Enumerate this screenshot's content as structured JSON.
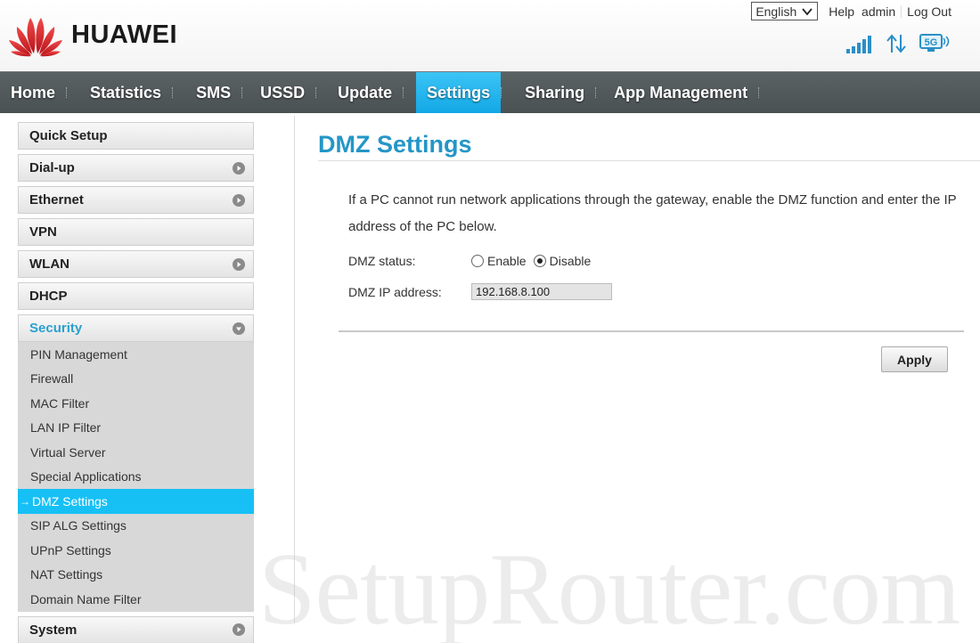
{
  "header": {
    "brand": "HUAWEI",
    "language": "English",
    "links": [
      "Help",
      "admin",
      "Log Out"
    ],
    "status_icons": [
      "signal-strength-icon",
      "data-transfer-icon",
      "5g-wifi-icon"
    ],
    "wifi_band_label": "5G"
  },
  "nav": {
    "items": [
      {
        "label": "Home",
        "active": false
      },
      {
        "label": "Statistics",
        "active": false
      },
      {
        "label": "SMS",
        "active": false
      },
      {
        "label": "USSD",
        "active": false
      },
      {
        "label": "Update",
        "active": false
      },
      {
        "label": "Settings",
        "active": true
      },
      {
        "label": "Sharing",
        "active": false
      },
      {
        "label": "App Management",
        "active": false
      }
    ]
  },
  "sidebar": {
    "items": [
      {
        "label": "Quick Setup",
        "expandable": false
      },
      {
        "label": "Dial-up",
        "expandable": true
      },
      {
        "label": "Ethernet",
        "expandable": true
      },
      {
        "label": "VPN",
        "expandable": false
      },
      {
        "label": "WLAN",
        "expandable": true
      },
      {
        "label": "DHCP",
        "expandable": false
      },
      {
        "label": "Security",
        "expandable": true,
        "open": true
      },
      {
        "label": "System",
        "expandable": true
      }
    ],
    "security_subitems": [
      "PIN Management",
      "Firewall",
      "MAC Filter",
      "LAN IP Filter",
      "Virtual Server",
      "Special Applications",
      "DMZ Settings",
      "SIP ALG Settings",
      "UPnP Settings",
      "NAT Settings",
      "Domain Name Filter"
    ],
    "active_subitem_arrow": "→"
  },
  "main": {
    "title": "DMZ Settings",
    "description": "If a PC cannot run network applications through the gateway, enable the DMZ function and enter the IP address of the PC below.",
    "dmz_status": {
      "label": "DMZ status:",
      "options": [
        "Enable",
        "Disable"
      ],
      "selected": "Disable"
    },
    "dmz_ip": {
      "label": "DMZ IP address:",
      "value": "192.168.8.100"
    },
    "apply_label": "Apply"
  },
  "watermark": "SetupRouter.com",
  "colors": {
    "accent": "#16c0f5",
    "title_blue": "#2496c7",
    "nav_bg": "#51585a",
    "brand_red": "#e0242b"
  }
}
